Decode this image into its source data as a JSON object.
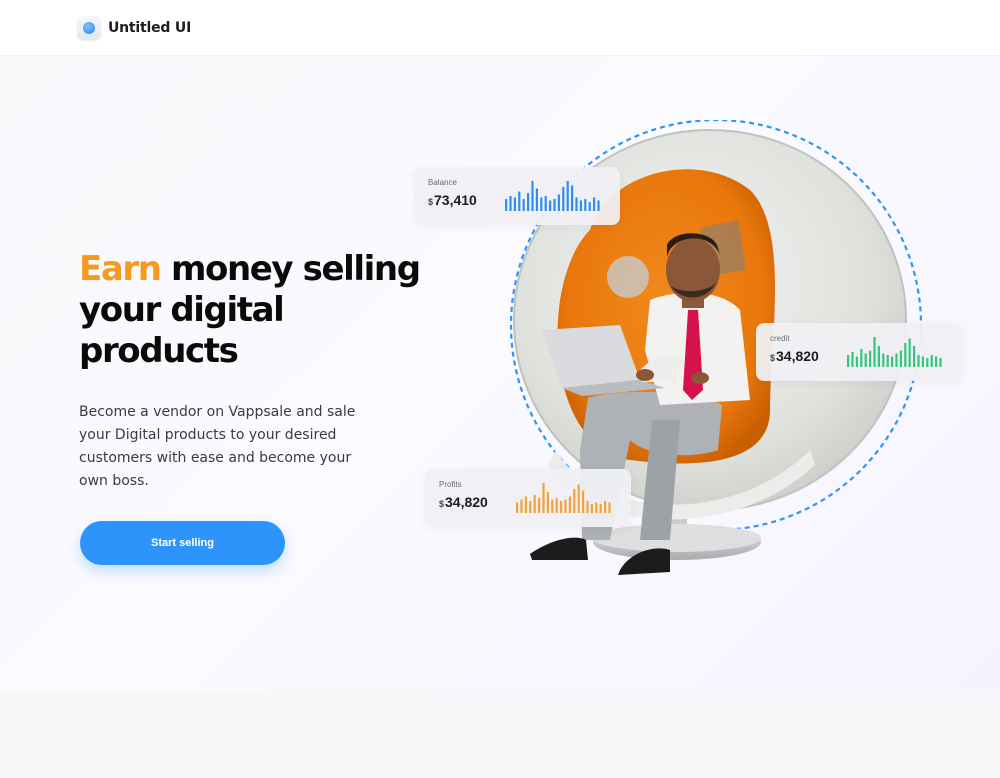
{
  "header": {
    "brand_name": "Untitled UI",
    "logo_icon": "blue-orb-logo-icon"
  },
  "hero": {
    "headline_accent": "Earn",
    "headline_rest": " money selling your digital products",
    "description": "Become a vendor on Vappsale and sale your Digital products to your desired customers with ease and become your own boss.",
    "cta_label": "Start selling"
  },
  "stats": {
    "balance": {
      "label": "Balance",
      "currency": "$",
      "value": "73,410",
      "color": "#2d8ef0",
      "bars": [
        0.4,
        0.5,
        0.45,
        0.65,
        0.4,
        0.6,
        1.0,
        0.75,
        0.45,
        0.5,
        0.35,
        0.4,
        0.55,
        0.8,
        1.0,
        0.85,
        0.45,
        0.35,
        0.4,
        0.3,
        0.45,
        0.35
      ]
    },
    "credit": {
      "label": "credit",
      "currency": "$",
      "value": "34,820",
      "color": "#34c77b",
      "bars": [
        0.4,
        0.5,
        0.35,
        0.6,
        0.45,
        0.55,
        1.0,
        0.7,
        0.45,
        0.4,
        0.35,
        0.45,
        0.55,
        0.8,
        0.95,
        0.7,
        0.4,
        0.35,
        0.3,
        0.4,
        0.35,
        0.3
      ]
    },
    "profits": {
      "label": "Profits",
      "currency": "$",
      "value": "34,820",
      "color": "#f5a13a",
      "bars": [
        0.35,
        0.45,
        0.55,
        0.4,
        0.6,
        0.5,
        1.0,
        0.7,
        0.45,
        0.5,
        0.4,
        0.45,
        0.55,
        0.8,
        0.95,
        0.75,
        0.4,
        0.3,
        0.35,
        0.3,
        0.4,
        0.35
      ]
    }
  },
  "colors": {
    "accent_orange": "#f59a1e",
    "primary_blue": "#2d94fb"
  }
}
